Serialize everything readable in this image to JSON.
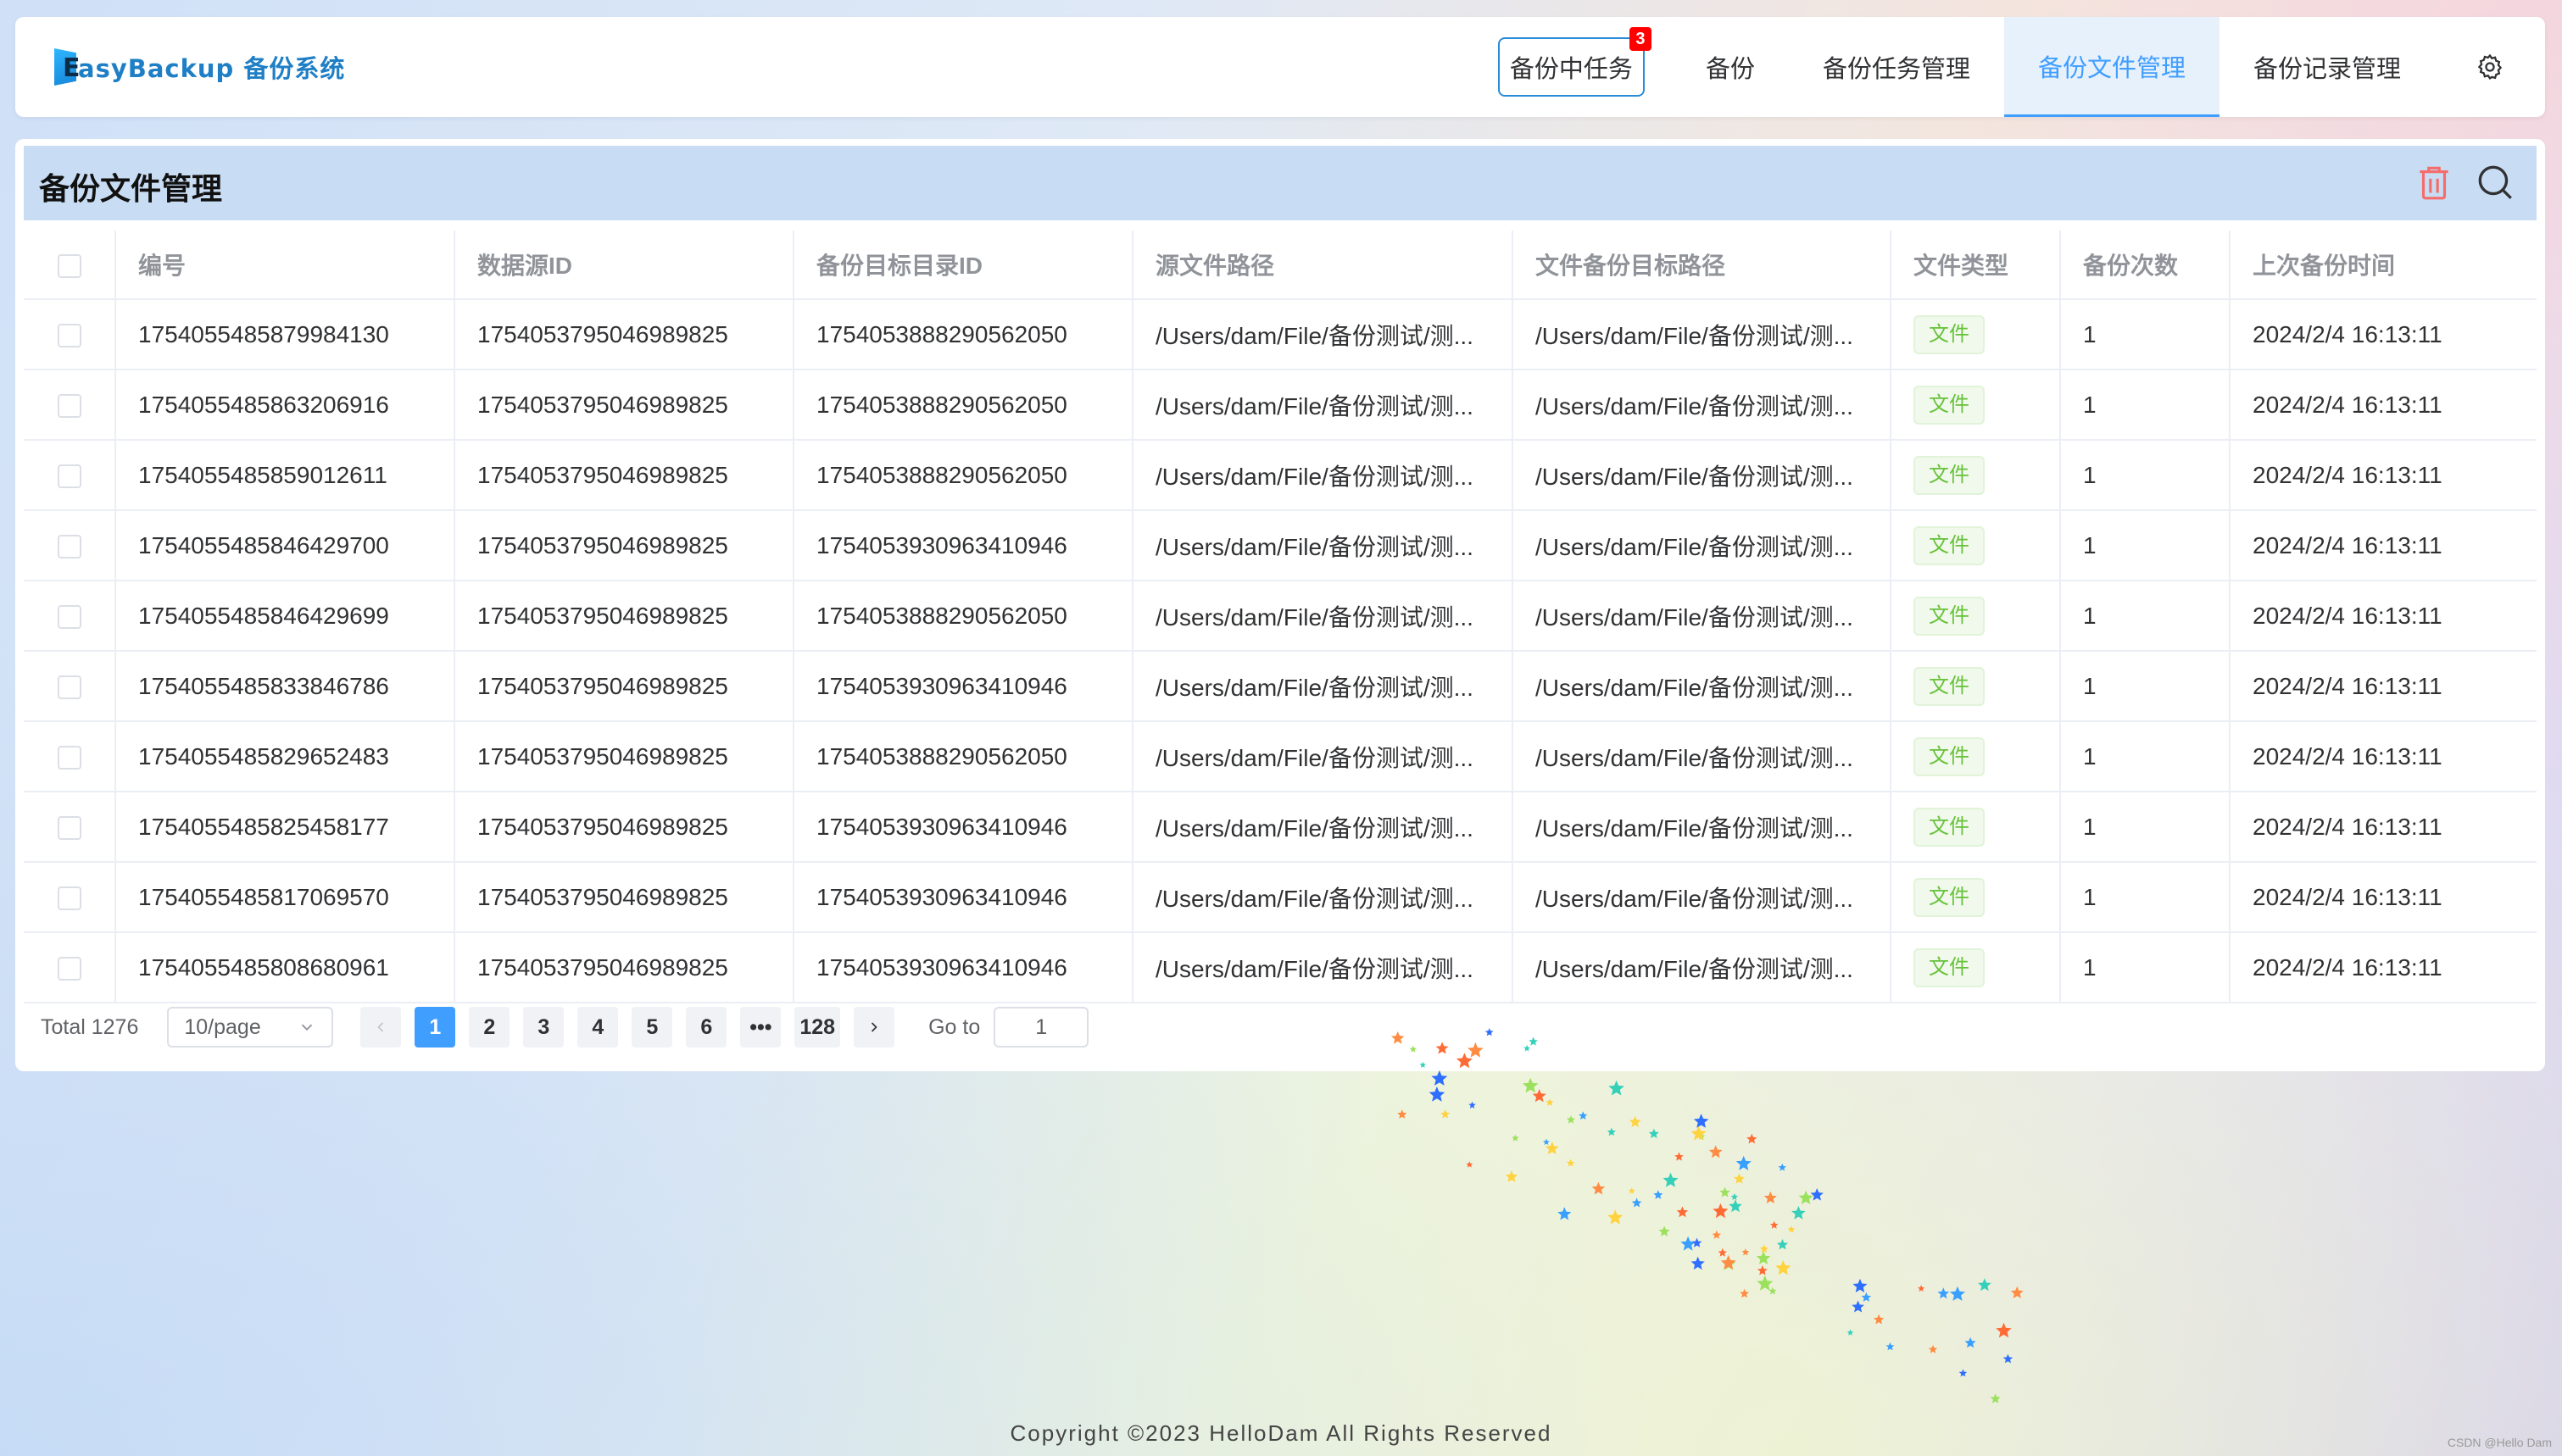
{
  "app": {
    "logo_initial": "E",
    "logo_text": "asyBackup 备份系统"
  },
  "nav": {
    "running": {
      "label": "备份中任务",
      "badge": "3"
    },
    "items": [
      {
        "label": "备份"
      },
      {
        "label": "备份任务管理"
      },
      {
        "label": "备份文件管理",
        "active": true
      },
      {
        "label": "备份记录管理"
      }
    ],
    "settings_icon": "gear-icon"
  },
  "panel": {
    "title": "备份文件管理",
    "delete_icon": "trash-icon",
    "search_icon": "search-icon",
    "columns": [
      "编号",
      "数据源ID",
      "备份目标目录ID",
      "源文件路径",
      "文件备份目标路径",
      "文件类型",
      "备份次数",
      "上次备份时间"
    ],
    "rows": [
      [
        "1754055485879984130",
        "1754053795046989825",
        "1754053888290562050",
        "/Users/dam/File/备份测试/测...",
        "/Users/dam/File/备份测试/测...",
        "文件",
        "1",
        "2024/2/4 16:13:11"
      ],
      [
        "1754055485863206916",
        "1754053795046989825",
        "1754053888290562050",
        "/Users/dam/File/备份测试/测...",
        "/Users/dam/File/备份测试/测...",
        "文件",
        "1",
        "2024/2/4 16:13:11"
      ],
      [
        "1754055485859012611",
        "1754053795046989825",
        "1754053888290562050",
        "/Users/dam/File/备份测试/测...",
        "/Users/dam/File/备份测试/测...",
        "文件",
        "1",
        "2024/2/4 16:13:11"
      ],
      [
        "1754055485846429700",
        "1754053795046989825",
        "1754053930963410946",
        "/Users/dam/File/备份测试/测...",
        "/Users/dam/File/备份测试/测...",
        "文件",
        "1",
        "2024/2/4 16:13:11"
      ],
      [
        "1754055485846429699",
        "1754053795046989825",
        "1754053888290562050",
        "/Users/dam/File/备份测试/测...",
        "/Users/dam/File/备份测试/测...",
        "文件",
        "1",
        "2024/2/4 16:13:11"
      ],
      [
        "1754055485833846786",
        "1754053795046989825",
        "1754053930963410946",
        "/Users/dam/File/备份测试/测...",
        "/Users/dam/File/备份测试/测...",
        "文件",
        "1",
        "2024/2/4 16:13:11"
      ],
      [
        "1754055485829652483",
        "1754053795046989825",
        "1754053888290562050",
        "/Users/dam/File/备份测试/测...",
        "/Users/dam/File/备份测试/测...",
        "文件",
        "1",
        "2024/2/4 16:13:11"
      ],
      [
        "1754055485825458177",
        "1754053795046989825",
        "1754053930963410946",
        "/Users/dam/File/备份测试/测...",
        "/Users/dam/File/备份测试/测...",
        "文件",
        "1",
        "2024/2/4 16:13:11"
      ],
      [
        "1754055485817069570",
        "1754053795046989825",
        "1754053930963410946",
        "/Users/dam/File/备份测试/测...",
        "/Users/dam/File/备份测试/测...",
        "文件",
        "1",
        "2024/2/4 16:13:11"
      ],
      [
        "1754055485808680961",
        "1754053795046989825",
        "1754053930963410946",
        "/Users/dam/File/备份测试/测...",
        "/Users/dam/File/备份测试/测...",
        "文件",
        "1",
        "2024/2/4 16:13:11"
      ]
    ]
  },
  "pagination": {
    "total": "Total 1276",
    "page_size": "10/page",
    "prev_icon": "chevron-left-icon",
    "next_icon": "chevron-right-icon",
    "pages": [
      "1",
      "2",
      "3",
      "4",
      "5",
      "6",
      "•••",
      "128"
    ],
    "current": "1",
    "goto_label": "Go to",
    "goto_value": "1"
  },
  "footer": {
    "copyright": "Copyright  ©2023  HelloDam  All Rights Reserved",
    "watermark": "CSDN @Hello Dam"
  },
  "colors": {
    "accent": "#409eff",
    "badge": "#ff0000",
    "tag_green": "#67c23a",
    "trash": "#f56c6c",
    "panel_header": "#c8dcf3"
  }
}
